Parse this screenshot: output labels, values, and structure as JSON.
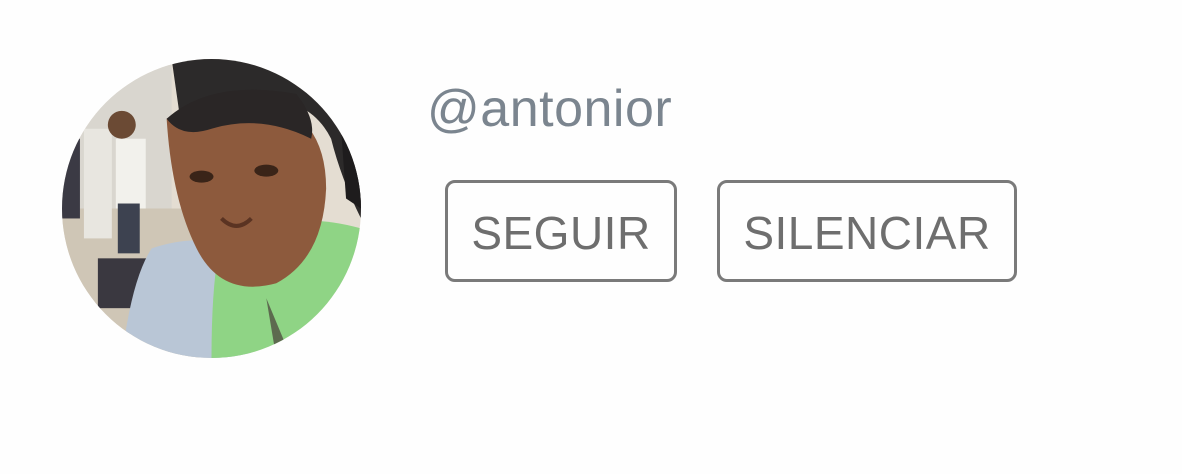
{
  "profile": {
    "username": "@antonior",
    "avatar_icon": "user-photo-avatar"
  },
  "actions": {
    "follow_label": "SEGUIR",
    "mute_label": "SILENCIAR"
  },
  "colors": {
    "username_text": "#7b858f",
    "button_text": "#6e6e6e",
    "button_border": "#7a7a7a",
    "background": "#fefefe"
  }
}
